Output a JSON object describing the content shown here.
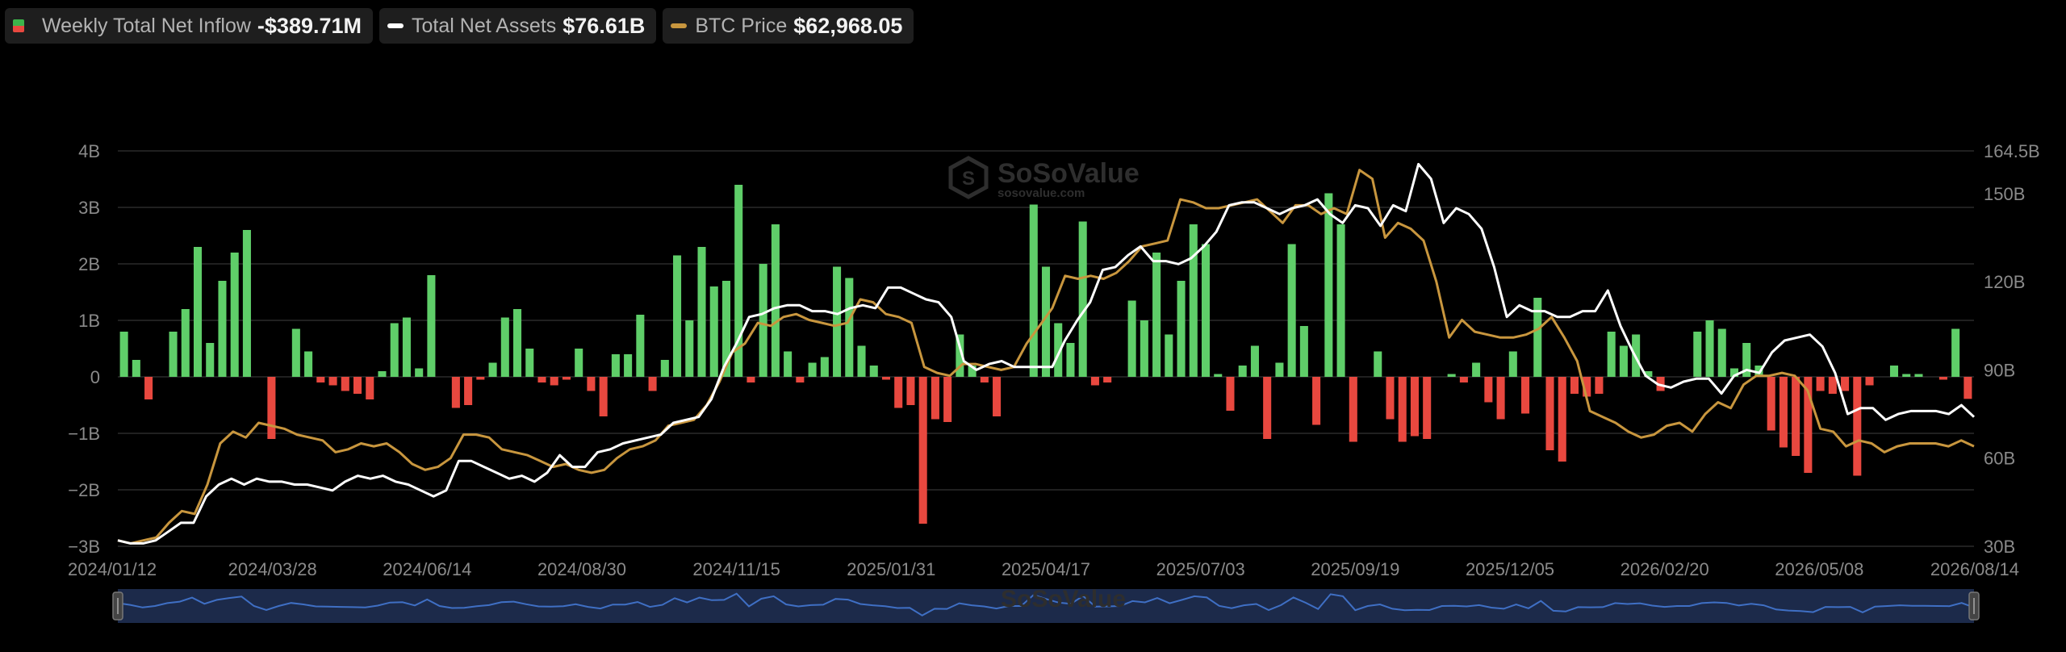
{
  "legend": [
    {
      "name": "Weekly Total Net Inflow",
      "value": "-$389.71M",
      "swatch": "bar"
    },
    {
      "name": "Total Net Assets",
      "value": "$76.61B",
      "swatch": "line",
      "color": "#ffffff"
    },
    {
      "name": "BTC Price",
      "value": "$62,968.05",
      "swatch": "line",
      "color": "#c8963e"
    }
  ],
  "watermark": {
    "brand": "SoSoValue",
    "site": "sosovalue.com"
  },
  "colors": {
    "positive": "#5fce69",
    "negative": "#e8483f",
    "assets": "#ffffff",
    "price": "#c8963e",
    "grid": "#2a2a2a",
    "navigator_bg": "#1c2a4a",
    "navigator_line": "#3f6fc4"
  },
  "chart_data": {
    "type": "bar",
    "x_tick_labels": [
      "2024/01/12",
      "2024/03/28",
      "2024/06/14",
      "2024/08/30",
      "2024/11/15",
      "2025/01/31",
      "2025/04/17",
      "2025/07/03",
      "2025/09/19",
      "2025/12/05",
      "2026/02/20",
      "2026/05/08",
      "2026/08/14"
    ],
    "y_left": {
      "ticks": [
        "4B",
        "3B",
        "2B",
        "1B",
        "0",
        "−1B",
        "−2B",
        "−3B"
      ],
      "range": [
        -3,
        4
      ],
      "unit": "B"
    },
    "y_right": {
      "ticks": [
        "164.5B",
        "150B",
        "120B",
        "90B",
        "60B",
        "30B"
      ],
      "range": [
        30,
        164.5
      ],
      "unit": "B"
    },
    "grid": true,
    "legend_position": "top-left",
    "series": [
      {
        "name": "Weekly Total Net Inflow",
        "type": "bar",
        "axis": "left",
        "values": [
          0.8,
          0.3,
          -0.4,
          0.0,
          0.8,
          1.2,
          2.3,
          0.6,
          1.7,
          2.2,
          2.6,
          0.0,
          -1.1,
          0.0,
          0.85,
          0.45,
          -0.1,
          -0.15,
          -0.25,
          -0.3,
          -0.4,
          0.1,
          0.95,
          1.05,
          0.15,
          1.8,
          0.0,
          -0.55,
          -0.5,
          -0.05,
          0.25,
          1.05,
          1.2,
          0.5,
          -0.1,
          -0.15,
          -0.05,
          0.5,
          -0.25,
          -0.7,
          0.4,
          0.4,
          1.1,
          -0.25,
          0.3,
          2.15,
          1.0,
          2.3,
          1.6,
          1.7,
          3.4,
          -0.1,
          2.0,
          2.7,
          0.45,
          -0.1,
          0.25,
          0.35,
          1.95,
          1.75,
          0.55,
          0.2,
          -0.05,
          -0.55,
          -0.5,
          -2.6,
          -0.75,
          -0.8,
          0.75,
          0.2,
          -0.1,
          -0.7,
          0.0,
          0.0,
          3.05,
          1.95,
          0.95,
          0.6,
          2.75,
          -0.15,
          -0.1,
          0.0,
          1.35,
          1.0,
          2.2,
          0.75,
          1.7,
          2.7,
          2.35,
          0.05,
          -0.6,
          0.2,
          0.55,
          -1.1,
          0.25,
          2.35,
          0.9,
          -0.85,
          3.25,
          2.7,
          -1.15,
          0.0,
          0.45,
          -0.75,
          -1.15,
          -1.05,
          -1.1,
          0.0,
          0.05,
          -0.1,
          0.25,
          -0.45,
          -0.75,
          0.45,
          -0.65,
          1.4,
          -1.3,
          -1.5,
          -0.3,
          -0.35,
          -0.3,
          0.8,
          0.55,
          0.75,
          0.1,
          -0.25,
          0.0,
          0.0,
          0.8,
          1.0,
          0.85,
          0.15,
          0.6,
          0.2,
          -0.95,
          -1.25,
          -1.4,
          -1.7,
          -0.25,
          -0.3,
          -0.25,
          -1.75,
          -0.15,
          0.0,
          0.2,
          0.05,
          0.05,
          0.0,
          -0.05,
          0.85,
          -0.39
        ]
      },
      {
        "name": "Total Net Assets",
        "type": "line",
        "axis": "right",
        "values": [
          32,
          31,
          31,
          32,
          35,
          38,
          38,
          47,
          51,
          53,
          51,
          53,
          52,
          52,
          51,
          51,
          50,
          49,
          52,
          54,
          53,
          54,
          52,
          51,
          49,
          47,
          49,
          59,
          59,
          57,
          55,
          53,
          54,
          52,
          55,
          61,
          57,
          57,
          62,
          63,
          65,
          66,
          67,
          68,
          72,
          73,
          74,
          80,
          91,
          99,
          108,
          109,
          111,
          112,
          112,
          110,
          110,
          109,
          111,
          112,
          111,
          118,
          118,
          116,
          114,
          113,
          108,
          93,
          90,
          92,
          93,
          91,
          91,
          91,
          91,
          100,
          107,
          113,
          124,
          125,
          129,
          132,
          127,
          127,
          126,
          128,
          132,
          137,
          146,
          147,
          147,
          145,
          143,
          145,
          146,
          148,
          143,
          140,
          146,
          145,
          139,
          146,
          144,
          160,
          155,
          140,
          145,
          143,
          138,
          125,
          108,
          112,
          110,
          110,
          108,
          108,
          110,
          110,
          117,
          105,
          96,
          88,
          85,
          84,
          86,
          87,
          87,
          82,
          88,
          90,
          89,
          96,
          100,
          101,
          102,
          98,
          89,
          75,
          77,
          77,
          73,
          75,
          76,
          76,
          76,
          75,
          78,
          74
        ]
      },
      {
        "name": "BTC Price",
        "type": "line",
        "axis": "right",
        "values": [
          32,
          31,
          32,
          33,
          38,
          42,
          41,
          51,
          65,
          69,
          67,
          72,
          71,
          70,
          68,
          67,
          66,
          62,
          63,
          65,
          64,
          65,
          62,
          58,
          56,
          57,
          60,
          68,
          68,
          67,
          63,
          62,
          61,
          59,
          57,
          58,
          56,
          55,
          56,
          60,
          63,
          64,
          66,
          71,
          72,
          73,
          78,
          86,
          96,
          99,
          106,
          105,
          108,
          109,
          107,
          106,
          105,
          106,
          114,
          113,
          109,
          108,
          106,
          91,
          89,
          88,
          92,
          92,
          91,
          90,
          91,
          99,
          105,
          111,
          122,
          121,
          122,
          121,
          123,
          127,
          132,
          133,
          134,
          148,
          147,
          145,
          145,
          146,
          147,
          148,
          144,
          140,
          146,
          146,
          143,
          145,
          143,
          158,
          155,
          135,
          140,
          138,
          134,
          120,
          101,
          107,
          103,
          102,
          101,
          101,
          102,
          104,
          108,
          101,
          93,
          76,
          74,
          72,
          69,
          67,
          68,
          71,
          72,
          69,
          75,
          79,
          77,
          85,
          88,
          88,
          89,
          88,
          83,
          70,
          69,
          64,
          66,
          65,
          62,
          64,
          65,
          65,
          65,
          64,
          66,
          64
        ]
      }
    ]
  }
}
